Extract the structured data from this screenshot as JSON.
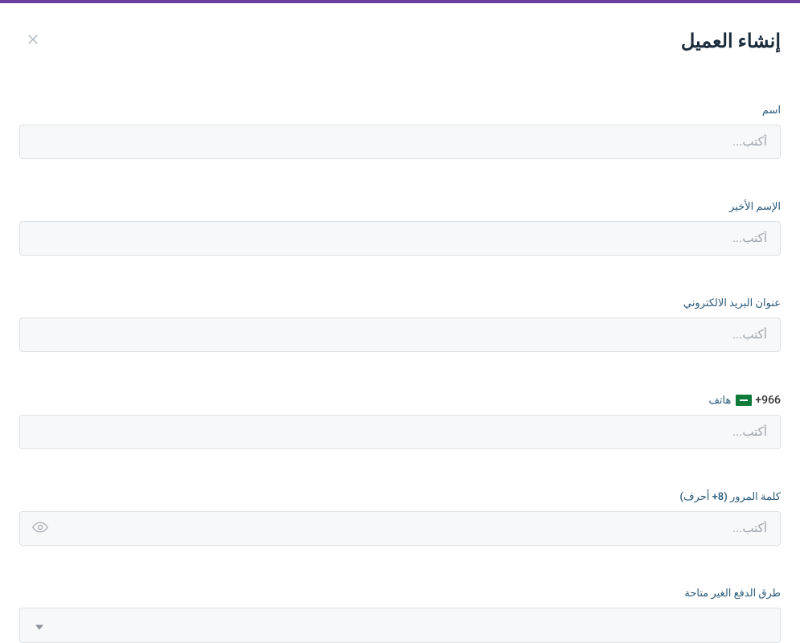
{
  "header": {
    "title": "إنشاء العميل"
  },
  "fields": {
    "first_name": {
      "label": "اسم",
      "placeholder": "أكتب..."
    },
    "last_name": {
      "label": "الإسم الأخير",
      "placeholder": "أكتب..."
    },
    "email": {
      "label": "عنوان البريد الالكتروني",
      "placeholder": "أكتب..."
    },
    "phone": {
      "label": "هاتف",
      "dial_code": "+966",
      "placeholder": "أكتب..."
    },
    "password": {
      "label": "كلمة المرور (8+ أحرف)",
      "placeholder": "أكتب..."
    },
    "payment_methods": {
      "label": "طرق الدفع الغير متاحة"
    }
  }
}
